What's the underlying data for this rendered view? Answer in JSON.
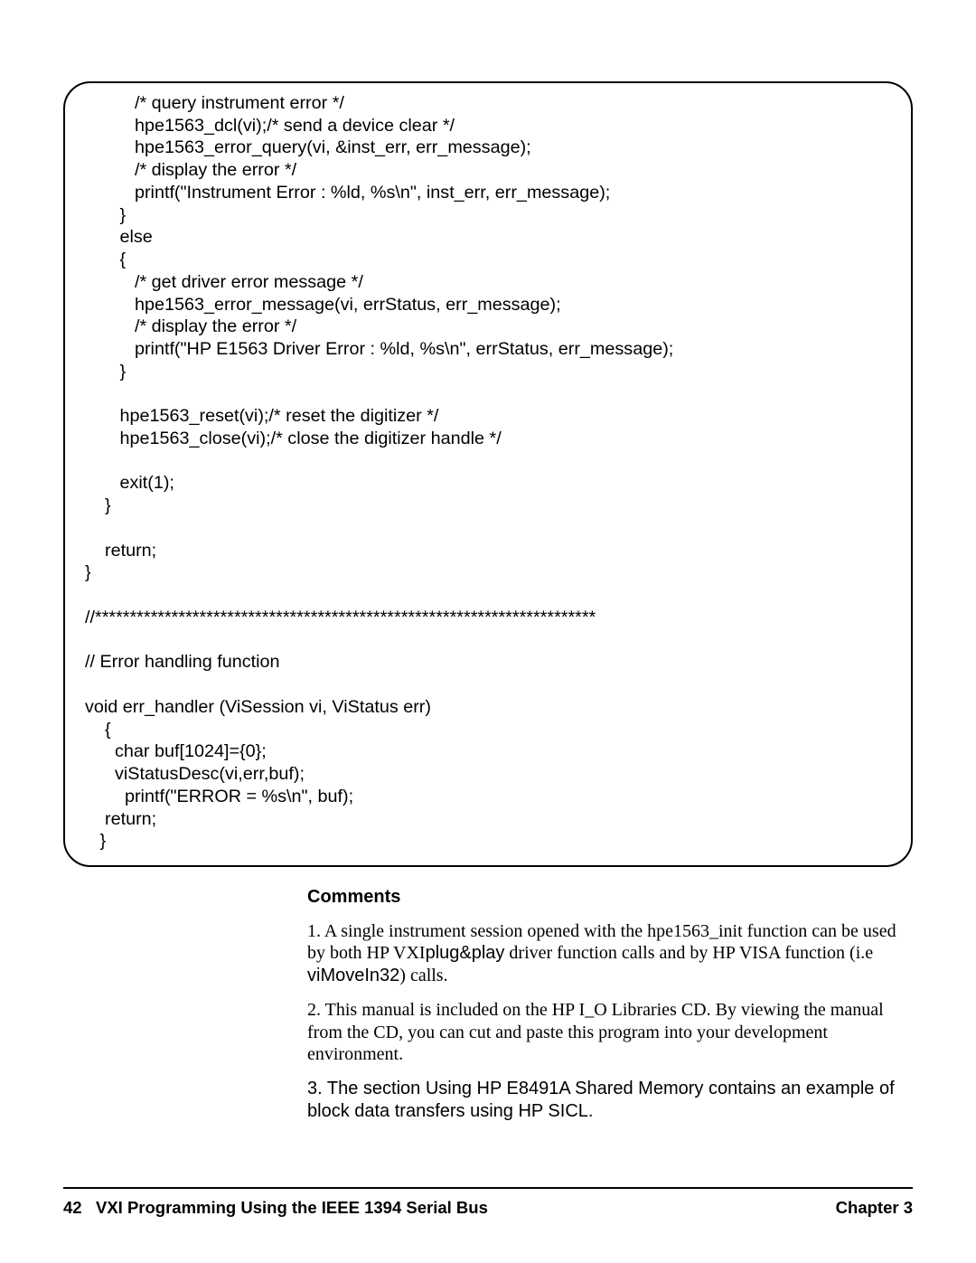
{
  "code": {
    "l01": "          /* query instrument error */",
    "l02": "          hpe1563_dcl(vi);/* send a device clear */",
    "l03": "          hpe1563_error_query(vi, &inst_err, err_message);",
    "l04": "          /* display the error */",
    "l05": "          printf(\"Instrument Error : %ld, %s\\n\", inst_err, err_message);",
    "l06": "       }",
    "l07": "       else",
    "l08": "       {",
    "l09": "          /* get driver error message */",
    "l10": "          hpe1563_error_message(vi, errStatus, err_message);",
    "l11": "          /* display the error */",
    "l12": "          printf(\"HP E1563 Driver Error : %ld, %s\\n\", errStatus, err_message);",
    "l13": "       }",
    "l14": "",
    "l15": "       hpe1563_reset(vi);/* reset the digitizer */",
    "l16": "       hpe1563_close(vi);/* close the digitizer handle */",
    "l17": "",
    "l18": "       exit(1);",
    "l19": "    }",
    "l20": "",
    "l21": "    return;",
    "l22": "}",
    "l23": "",
    "l24": "//************************************************************************",
    "l25": "",
    "l26": "// Error handling function",
    "l27": "",
    "l28": "void err_handler (ViSession vi, ViStatus err)",
    "l29": "    {",
    "l30": "      char buf[1024]={0};",
    "l31": "      viStatusDesc(vi,err,buf);",
    "l32": "        printf(\"ERROR = %s\\n\", buf);",
    "l33": "    return;",
    "l34": "   }"
  },
  "comments": {
    "heading": "Comments",
    "p1a": "1. A single instrument session opened with the hpe1563_init function can be used by both HP VXI",
    "p1b": "plug&play",
    "p1c": " driver function calls and by HP VISA function (i.e ",
    "p1d": "viMoveIn32",
    "p1e": ") calls.",
    "p2": "2. This manual is included on the HP I_O Libraries CD. By viewing the manual from the CD, you can cut and paste this program into your development environment.",
    "p3": "3. The section  Using HP E8491A Shared Memory  contains an example of block data transfers using HP SICL."
  },
  "footer": {
    "left_page": "42",
    "left_title": "VXI Programming Using the IEEE 1394 Serial Bus",
    "right": "Chapter 3"
  }
}
